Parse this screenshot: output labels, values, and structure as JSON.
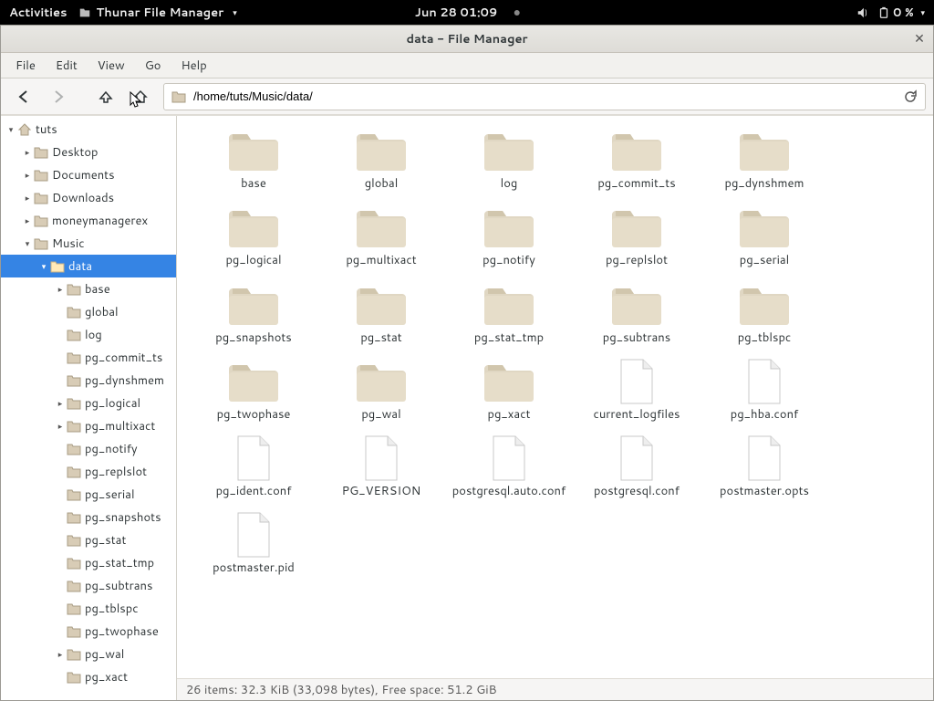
{
  "panel": {
    "activities": "Activities",
    "app": "Thunar File Manager",
    "clock": "Jun 28  01:09",
    "battery": "0 %"
  },
  "window": {
    "title": "data - File Manager"
  },
  "menubar": [
    "File",
    "Edit",
    "View",
    "Go",
    "Help"
  ],
  "location": {
    "path": "/home/tuts/Music/data/"
  },
  "sidebar_tree": [
    {
      "indent": 0,
      "exp": "down",
      "home": true,
      "label": "tuts"
    },
    {
      "indent": 1,
      "exp": "right",
      "label": "Desktop"
    },
    {
      "indent": 1,
      "exp": "right",
      "label": "Documents"
    },
    {
      "indent": 1,
      "exp": "right",
      "label": "Downloads"
    },
    {
      "indent": 1,
      "exp": "right",
      "label": "moneymanagerex"
    },
    {
      "indent": 1,
      "exp": "down",
      "label": "Music"
    },
    {
      "indent": 2,
      "exp": "down",
      "label": "data",
      "selected": true
    },
    {
      "indent": 3,
      "exp": "right",
      "label": "base"
    },
    {
      "indent": 3,
      "exp": "none",
      "label": "global"
    },
    {
      "indent": 3,
      "exp": "none",
      "label": "log"
    },
    {
      "indent": 3,
      "exp": "none",
      "label": "pg_commit_ts"
    },
    {
      "indent": 3,
      "exp": "none",
      "label": "pg_dynshmem"
    },
    {
      "indent": 3,
      "exp": "right",
      "label": "pg_logical"
    },
    {
      "indent": 3,
      "exp": "right",
      "label": "pg_multixact"
    },
    {
      "indent": 3,
      "exp": "none",
      "label": "pg_notify"
    },
    {
      "indent": 3,
      "exp": "none",
      "label": "pg_replslot"
    },
    {
      "indent": 3,
      "exp": "none",
      "label": "pg_serial"
    },
    {
      "indent": 3,
      "exp": "none",
      "label": "pg_snapshots"
    },
    {
      "indent": 3,
      "exp": "none",
      "label": "pg_stat"
    },
    {
      "indent": 3,
      "exp": "none",
      "label": "pg_stat_tmp"
    },
    {
      "indent": 3,
      "exp": "none",
      "label": "pg_subtrans"
    },
    {
      "indent": 3,
      "exp": "none",
      "label": "pg_tblspc"
    },
    {
      "indent": 3,
      "exp": "none",
      "label": "pg_twophase"
    },
    {
      "indent": 3,
      "exp": "right",
      "label": "pg_wal"
    },
    {
      "indent": 3,
      "exp": "none",
      "label": "pg_xact"
    }
  ],
  "items": [
    {
      "type": "folder",
      "name": "base"
    },
    {
      "type": "folder",
      "name": "global"
    },
    {
      "type": "folder",
      "name": "log"
    },
    {
      "type": "folder",
      "name": "pg_commit_ts"
    },
    {
      "type": "folder",
      "name": "pg_dynshmem"
    },
    {
      "type": "folder",
      "name": "pg_logical"
    },
    {
      "type": "folder",
      "name": "pg_multixact"
    },
    {
      "type": "folder",
      "name": "pg_notify"
    },
    {
      "type": "folder",
      "name": "pg_replslot"
    },
    {
      "type": "folder",
      "name": "pg_serial"
    },
    {
      "type": "folder",
      "name": "pg_snapshots"
    },
    {
      "type": "folder",
      "name": "pg_stat"
    },
    {
      "type": "folder",
      "name": "pg_stat_tmp"
    },
    {
      "type": "folder",
      "name": "pg_subtrans"
    },
    {
      "type": "folder",
      "name": "pg_tblspc"
    },
    {
      "type": "folder",
      "name": "pg_twophase"
    },
    {
      "type": "folder",
      "name": "pg_wal"
    },
    {
      "type": "folder",
      "name": "pg_xact"
    },
    {
      "type": "file",
      "name": "current_logfiles"
    },
    {
      "type": "file",
      "name": "pg_hba.conf"
    },
    {
      "type": "file",
      "name": "pg_ident.conf"
    },
    {
      "type": "file",
      "name": "PG_VERSION"
    },
    {
      "type": "file",
      "name": "postgresql.auto.conf"
    },
    {
      "type": "file",
      "name": "postgresql.conf"
    },
    {
      "type": "file",
      "name": "postmaster.opts"
    },
    {
      "type": "file",
      "name": "postmaster.pid"
    }
  ],
  "statusbar": "26 items: 32.3 KiB (33,098 bytes), Free space: 51.2 GiB"
}
